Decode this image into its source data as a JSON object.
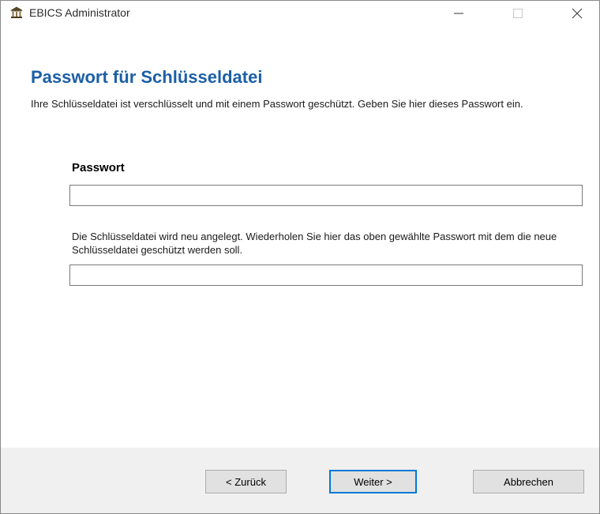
{
  "window": {
    "title": "EBICS Administrator",
    "icon": "bank-building-icon"
  },
  "page": {
    "heading": "Passwort für Schlüsseldatei",
    "intro": "Ihre Schlüsseldatei ist verschlüsselt und mit einem Passwort geschützt. Geben Sie hier dieses Passwort ein.",
    "password_label": "Passwort",
    "password_value": "",
    "repeat_text": "Die Schlüsseldatei wird neu angelegt. Wiederholen Sie hier das oben gewählte Passwort mit dem die neue Schlüsseldatei geschützt werden soll.",
    "repeat_value": ""
  },
  "buttons": {
    "back": "< Zurück",
    "next": "Weiter >",
    "cancel": "Abbrechen"
  },
  "colors": {
    "heading": "#1c5fa6",
    "focus_border": "#0078d7",
    "footer_bg": "#f0f0f0"
  }
}
